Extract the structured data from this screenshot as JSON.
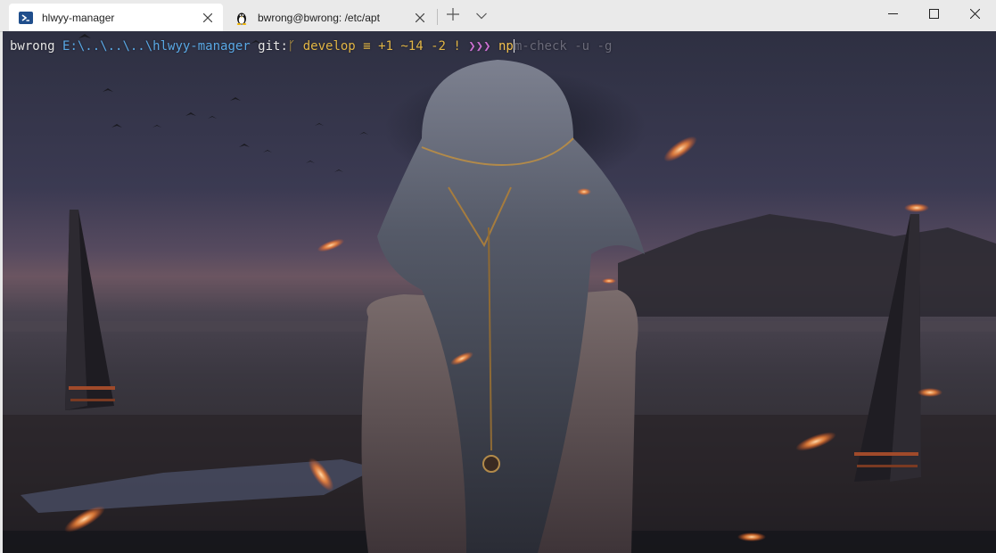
{
  "tabs": [
    {
      "label": "hlwyy-manager",
      "icon": "powershell-icon",
      "active": true
    },
    {
      "label": "bwrong@bwrong: /etc/apt",
      "icon": "linux-tux-icon",
      "active": false
    }
  ],
  "toolbar": {
    "new_tab_icon": "plus-icon",
    "dropdown_icon": "chevron-down-icon"
  },
  "window_controls": [
    "minimize-icon",
    "maximize-icon",
    "close-icon"
  ],
  "prompt": {
    "user": "bwrong",
    "path": "E:\\..\\..\\..\\hlwyy-manager",
    "git_label": "git:",
    "git_glyph": "ᚴ",
    "branch": "develop",
    "sync_glyph": "≡",
    "status": "+1 ~14 -2 !",
    "arrows": "❯❯❯",
    "typed": "np",
    "suggestion": "m-check -u -g"
  },
  "colors": {
    "user": "#e6e6e6",
    "path": "#5aa9e6",
    "git_label": "#e6e6e6",
    "branch": "#e2b646",
    "arrow_1": "#b86ad6",
    "arrow_2": "#c96fd0",
    "arrow_3": "#d47bc6",
    "typed": "#f2c14e",
    "suggestion": "#6b6b7a"
  }
}
